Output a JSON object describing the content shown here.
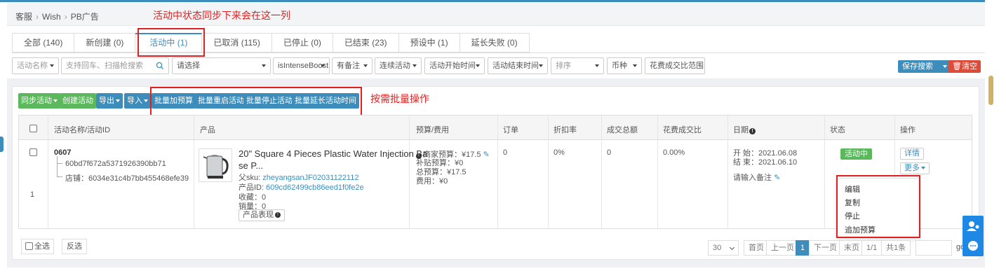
{
  "breadcrumb": [
    "客服",
    "Wish",
    "PB广告"
  ],
  "annotations": {
    "top": "活动中状态同步下来会在这一列",
    "batch": "按需批量操作"
  },
  "tabs": [
    {
      "label": "全部 (140)"
    },
    {
      "label": "新创建 (0)"
    },
    {
      "label": "活动中 (1)"
    },
    {
      "label": "已取消 (115)"
    },
    {
      "label": "已停止 (0)"
    },
    {
      "label": "已结束 (23)"
    },
    {
      "label": "预设中 (1)"
    },
    {
      "label": "延长失败 (0)"
    }
  ],
  "filters": {
    "campaign_name": "活动名称",
    "search_placeholder": "支持回车、扫描枪搜索",
    "select": "请选择",
    "intense_boost": "isIntenseBoost",
    "remark": "有备注",
    "continuous": "连续活动",
    "start_time": "活动开始时间",
    "end_time": "活动结束时间",
    "sort": "排序",
    "currency": "币种",
    "spend_ratio": "花费成交比范围",
    "save_search": "保存搜索",
    "clear": "清空"
  },
  "actions": {
    "sync": "同步活动",
    "create": "创建活动",
    "export": "导出",
    "import": "导入",
    "batch_budget": "批量加预算",
    "batch_restart": "批量重启活动",
    "batch_stop": "批量停止活动",
    "batch_extend": "批量延长活动时间"
  },
  "table": {
    "headers": {
      "name": "活动名称/活动ID",
      "product": "产品",
      "budget": "预算/费用",
      "orders": "订单",
      "discount": "折扣率",
      "gmv": "成交总额",
      "spend_ratio": "花费成交比",
      "date": "日期",
      "status": "状态",
      "ops": "操作"
    },
    "row": {
      "index": "1",
      "name": "0607",
      "campaign_id": "60bd7f672a5371926390bb71",
      "store": "店铺：6034e31c4b7bb455468efe39",
      "product_title_1": "20\" Square 4 Pieces Plastic Water Injection Ba",
      "product_title_2": "se P...",
      "parent_sku_label": "父sku:",
      "parent_sku": "zheyangsanJF02031122112",
      "product_id_label": "产品ID:",
      "product_id": "609cd62499cb86eed1f0fe2e",
      "favorites": "收藏：0",
      "sales": "销量：0",
      "perf_button": "产品表现",
      "merchant_budget": "商家预算：¥17.5",
      "subsidy_budget": "补贴预算：¥0",
      "total_budget": "总预算：¥17.5",
      "cost": "费用：¥0",
      "orders": "0",
      "discount": "0%",
      "gmv": "0",
      "spend_ratio": "0.00%",
      "start": "开 始：2021.06.08",
      "end": "结 束：2021.06.10",
      "note": "请输入备注",
      "status": "活动中",
      "detail": "详情",
      "more": "更多"
    },
    "more_menu": [
      "编辑",
      "复制",
      "停止",
      "追加预算"
    ]
  },
  "footer": {
    "select_all": "全选",
    "invert": "反选",
    "page_size": "30",
    "first": "首页",
    "prev": "上一页",
    "current": "1",
    "next": "下一页",
    "last": "末页",
    "page_of": "1/1",
    "total": "共1条",
    "go": "go"
  },
  "colors": {
    "primary": "#3c8dbc",
    "success": "#5cb85c",
    "danger": "#dd4b39",
    "annotation": "#e02020"
  }
}
